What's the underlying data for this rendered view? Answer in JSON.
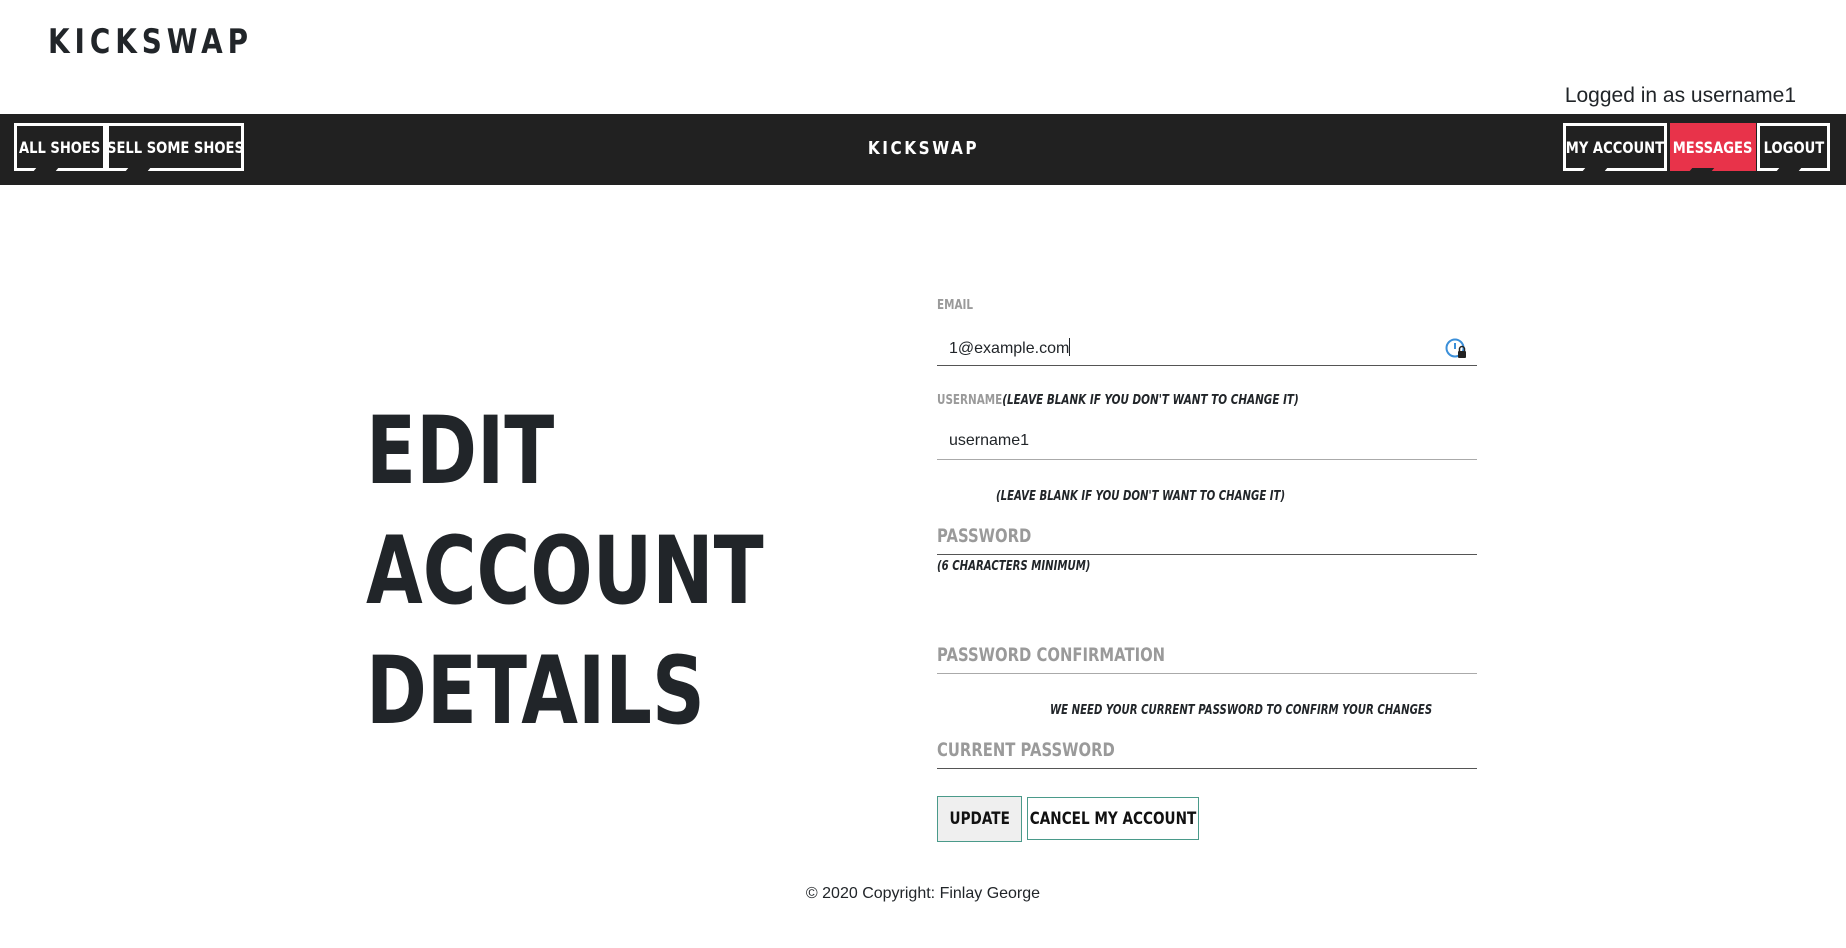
{
  "header": {
    "brand": "KICKSWAP",
    "logged_in_text": "Logged in as username1"
  },
  "navbar": {
    "brand": "KICKSWAP",
    "left_items": [
      {
        "label": "ALL SHOES"
      },
      {
        "label": "SELL SOME SHOES"
      }
    ],
    "right_items": [
      {
        "label": "MY ACCOUNT"
      },
      {
        "label": "MESSAGES"
      },
      {
        "label": "LOGOUT"
      }
    ]
  },
  "page": {
    "title_lines": [
      "EDIT",
      "ACCOUNT",
      "DETAILS"
    ]
  },
  "form": {
    "email": {
      "label": "EMAIL",
      "value": "1@example.com"
    },
    "username": {
      "label": "USERNAME",
      "hint": "(LEAVE BLANK IF YOU DON'T WANT TO CHANGE IT)",
      "value": "username1"
    },
    "password": {
      "hint_above": "(LEAVE BLANK IF YOU DON'T WANT TO CHANGE IT)",
      "placeholder": "PASSWORD",
      "hint_below": "(6 CHARACTERS MINIMUM)"
    },
    "password_confirmation": {
      "placeholder": "PASSWORD CONFIRMATION"
    },
    "current_password": {
      "hint": "WE NEED YOUR CURRENT PASSWORD TO CONFIRM YOUR CHANGES",
      "placeholder": "CURRENT PASSWORD"
    },
    "update_label": "UPDATE",
    "cancel_label": "CANCEL MY ACCOUNT"
  },
  "footer": {
    "copyright": "© 2020 Copyright: Finlay George"
  },
  "colors": {
    "navbar_bg": "#212121",
    "messages_accent": "#e8334a",
    "button_border": "#4a9a8a"
  },
  "icons": {
    "password_manager": "password-manager-icon"
  }
}
